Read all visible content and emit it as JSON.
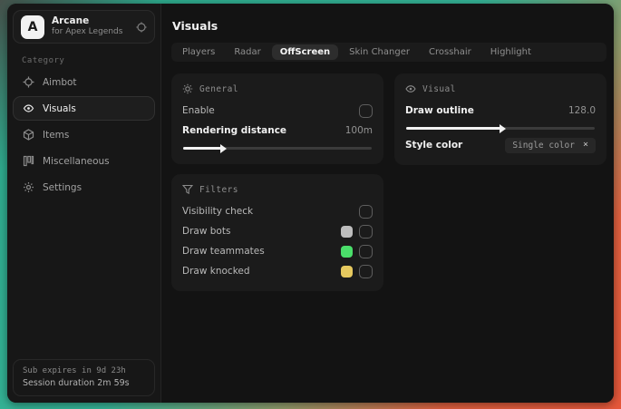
{
  "app": {
    "logo_letter": "A",
    "name": "Arcane",
    "subtitle": "for Apex Legends"
  },
  "sidebar": {
    "category_label": "Category",
    "items": [
      {
        "label": "Aimbot"
      },
      {
        "label": "Visuals"
      },
      {
        "label": "Items"
      },
      {
        "label": "Miscellaneous"
      },
      {
        "label": "Settings"
      }
    ],
    "active_item": "Visuals",
    "status": {
      "sub_expires": "Sub expires in 9d 23h",
      "session_duration": "Session duration 2m 59s"
    }
  },
  "main": {
    "title": "Visuals",
    "tabs": [
      {
        "label": "Players"
      },
      {
        "label": "Radar"
      },
      {
        "label": "OffScreen"
      },
      {
        "label": "Skin Changer"
      },
      {
        "label": "Crosshair"
      },
      {
        "label": "Highlight"
      }
    ],
    "active_tab": "OffScreen",
    "general": {
      "title": "General",
      "enable_label": "Enable",
      "enable_checked": false,
      "rendering_label": "Rendering distance",
      "rendering_value": "100m",
      "rendering_percent": 20
    },
    "visual": {
      "title": "Visual",
      "outline_label": "Draw outline",
      "outline_value": "128.0",
      "outline_percent": 50,
      "style_label": "Style color",
      "style_value": "Single color",
      "style_clear": "×"
    },
    "filters": {
      "title": "Filters",
      "rows": [
        {
          "label": "Visibility check",
          "checked": false
        },
        {
          "label": "Draw bots",
          "swatch": "#bdbdbd",
          "checked": false
        },
        {
          "label": "Draw teammates",
          "swatch": "#4ade6a",
          "checked": false
        },
        {
          "label": "Draw knocked",
          "swatch": "#e6c95f",
          "checked": false
        }
      ]
    }
  },
  "colors": {
    "desktop_teal": "#35b497",
    "desktop_orange": "#e5573a",
    "panel_bg": "#1b1b1b",
    "slider_fill": "#f2f2f2"
  }
}
